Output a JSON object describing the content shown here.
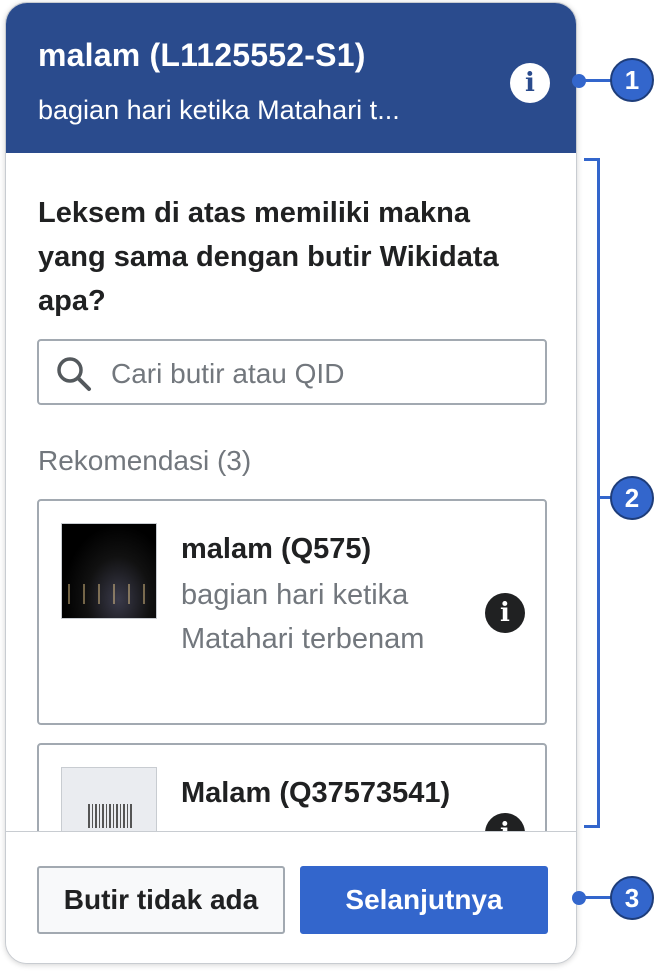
{
  "lexeme": {
    "title": "malam (L1125552-S1)",
    "subtitle": "bagian hari ketika Matahari t...",
    "info_icon": "info-icon"
  },
  "question": "Leksem di atas memiliki makna yang sama dengan butir Wikidata apa?",
  "search": {
    "placeholder": "Cari butir atau QID",
    "value": ""
  },
  "recommendations": {
    "label": "Rekomendasi (3)",
    "items": [
      {
        "name": "malam (Q575)",
        "description": "bagian hari ketika Matahari terbenam",
        "thumbnail": "night-city-photo"
      },
      {
        "name": "Malam (Q37573541)",
        "description": "",
        "thumbnail": "barcode-placeholder"
      }
    ]
  },
  "footer": {
    "secondary_label": "Butir tidak ada",
    "primary_label": "Selanjutnya"
  },
  "annotations": [
    "1",
    "2",
    "3"
  ],
  "colors": {
    "header_bg": "#2a4b8d",
    "accent": "#3366cc",
    "text": "#202122",
    "muted": "#72777d"
  }
}
